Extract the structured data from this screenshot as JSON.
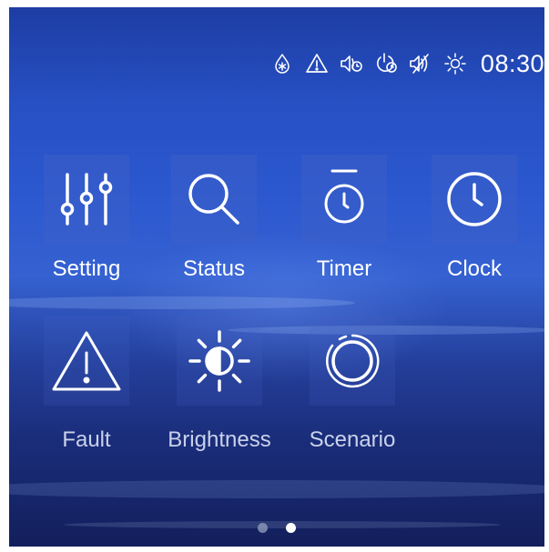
{
  "status_bar": {
    "icons": [
      "defrost-icon",
      "warning-icon",
      "sound-timer-icon",
      "power-timer-icon",
      "mute-icon",
      "brightness-icon"
    ],
    "time": "08:30"
  },
  "menu": {
    "items": [
      {
        "label": "Setting",
        "icon": "sliders-icon"
      },
      {
        "label": "Status",
        "icon": "search-icon"
      },
      {
        "label": "Timer",
        "icon": "stopwatch-icon"
      },
      {
        "label": "Clock",
        "icon": "clock-icon"
      },
      {
        "label": "Fault",
        "icon": "warning-icon"
      },
      {
        "label": "Brightness",
        "icon": "brightness-icon"
      },
      {
        "label": "Scenario",
        "icon": "scenario-icon"
      }
    ]
  },
  "pagination": {
    "page_count": 2,
    "current_page": 2
  },
  "colors": {
    "background_top": "#1d3da3",
    "background_mid": "#3561d1",
    "background_bottom": "#131f5c",
    "foreground": "#ffffff"
  }
}
